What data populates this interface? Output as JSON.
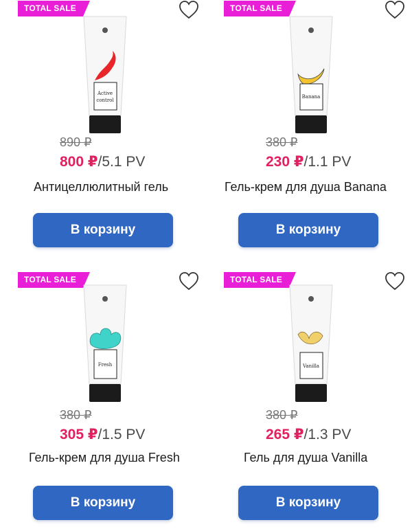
{
  "badge_text": "TOTAL SALE",
  "cart_button_label": "В корзину",
  "products": [
    {
      "old_price": "890 ₽",
      "price": "800 ₽",
      "pv": "/5.1 PV",
      "title": "Антицеллюлитный гель",
      "tube_label": "Active control",
      "accent": "#e8262a"
    },
    {
      "old_price": "380 ₽",
      "price": "230 ₽",
      "pv": "/1.1 PV",
      "title": "Гель-крем для душа Banana",
      "tube_label": "Banana",
      "accent": "#f5c531"
    },
    {
      "old_price": "380 ₽",
      "price": "305 ₽",
      "pv": "/1.5 PV",
      "title": "Гель-крем для душа Fresh",
      "tube_label": "Fresh",
      "accent": "#3fd3c9"
    },
    {
      "old_price": "380 ₽",
      "price": "265 ₽",
      "pv": "/1.3 PV",
      "title": "Гель для душа Vanilla",
      "tube_label": "Vanilla",
      "accent": "#f1cf6a"
    }
  ],
  "colors": {
    "badge": "#e81fd6",
    "price": "#e0215f",
    "button": "#2f67c2"
  }
}
